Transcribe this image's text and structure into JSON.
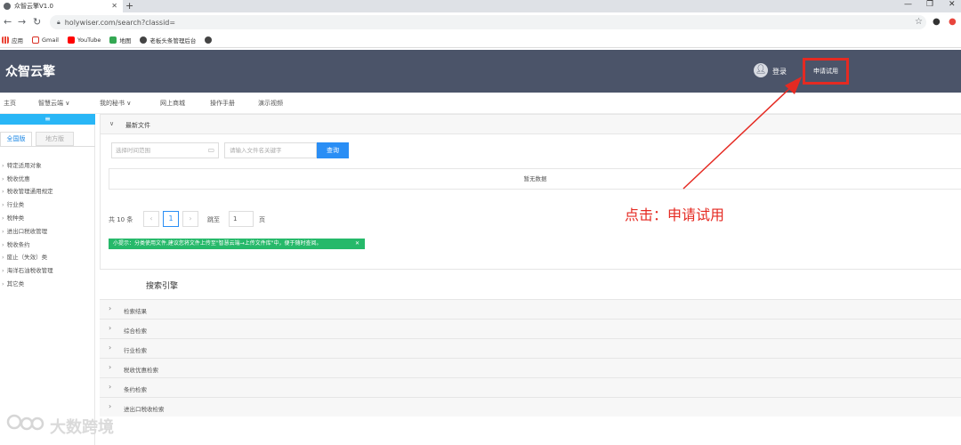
{
  "browser": {
    "tab_title": "众智云擎V1.0",
    "new_tab": "+",
    "url": "holywiser.com/search?classid=",
    "window_minimize": "—",
    "window_maximize": "❐",
    "window_close": "✕",
    "bookmarks": [
      {
        "label": "应用",
        "color": "#ea4335"
      },
      {
        "label": "Gmail",
        "color": "#d93025"
      },
      {
        "label": "YouTube",
        "color": "#ff0000"
      },
      {
        "label": "地图",
        "color": "#34a853"
      },
      {
        "label": "老板头条管理后台",
        "color": "#444444"
      },
      {
        "label": "",
        "color": "#444444"
      }
    ]
  },
  "header": {
    "brand": "众智云擎",
    "login": "登录",
    "apply": "申请试用"
  },
  "menu": {
    "items": [
      "主页",
      "智慧云端 ∨",
      "我的秘书 ∨",
      "网上商城",
      "操作手册",
      "演示视频"
    ]
  },
  "sidebar": {
    "bar_label": "≡",
    "tab_national": "全国版",
    "tab_local": "地方版",
    "items": [
      "特定适用对象",
      "税收优惠",
      "税收管理通用规定",
      "行业类",
      "税种类",
      "进出口税收管理",
      "税收条约",
      "废止（失效）类",
      "海洋石油税收管理",
      "其它类"
    ]
  },
  "panel": {
    "title": "最新文件",
    "date_placeholder": "选择时间范围",
    "keyword_placeholder": "请输入文件名关键字",
    "search_button": "查询",
    "empty": "暂无数据",
    "total": "共 10 条",
    "prev": "‹",
    "current_page": "1",
    "next": "›",
    "goto": "跳至",
    "goto_value": "1",
    "page_unit": "页",
    "tip": "小提示：分类使用文件,建议您将文件上传至\"智慧云端→上传文件库\"中，便于随时查阅。",
    "tip_close": "✕"
  },
  "search_engine": {
    "title": "搜索引擎",
    "rows": [
      "检索结果",
      "综合检索",
      "行业检索",
      "税收优惠检索",
      "条约检索",
      "进出口税收检索"
    ]
  },
  "annotation": {
    "text": "点击：申请试用",
    "color": "#e52a22"
  },
  "watermark": {
    "text": "大数跨境"
  }
}
